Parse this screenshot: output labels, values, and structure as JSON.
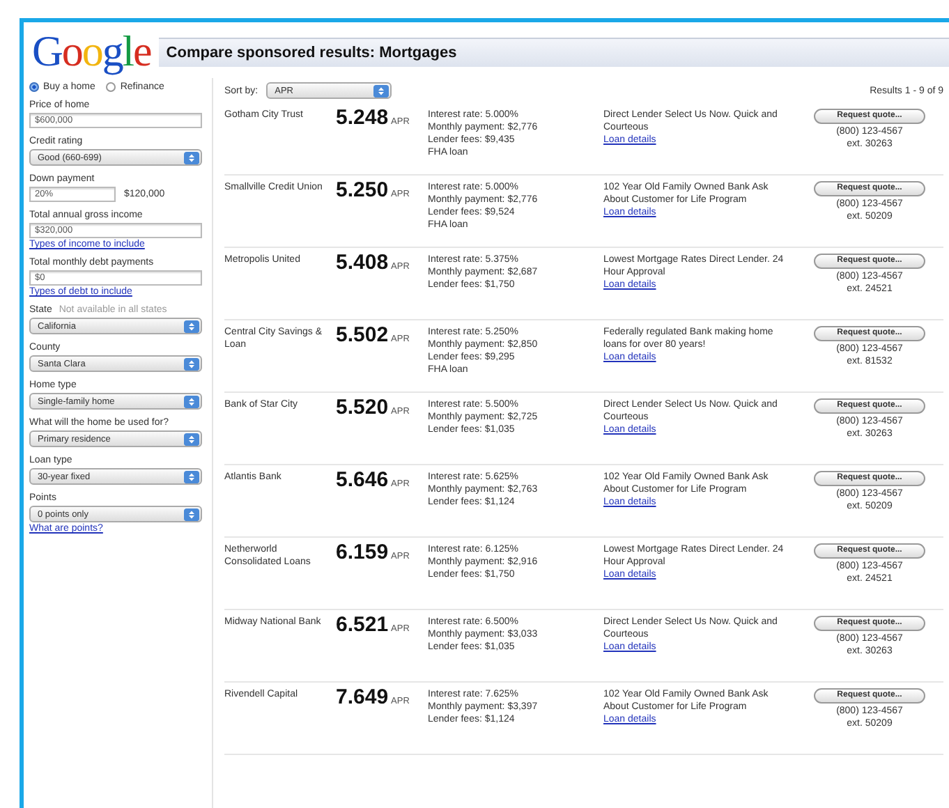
{
  "header": {
    "logo": "Google",
    "title": "Compare sponsored results: Mortgages"
  },
  "sidebar": {
    "purpose": [
      {
        "label": "Buy a home",
        "selected": true
      },
      {
        "label": "Refinance",
        "selected": false
      }
    ],
    "fields": [
      {
        "kind": "input",
        "label": "Price of home",
        "value": "$600,000"
      },
      {
        "kind": "select",
        "label": "Credit rating",
        "value": "Good (660-699)"
      },
      {
        "kind": "input",
        "label": "Down payment",
        "value": "20%",
        "amount": "$120,000"
      },
      {
        "kind": "input",
        "label": "Total annual gross income",
        "value": "$320,000",
        "link": "Types of income to include"
      },
      {
        "kind": "input",
        "label": "Total monthly debt payments",
        "value": "$0",
        "link": "Types of debt to include"
      },
      {
        "kind": "select",
        "label": "State",
        "note": "Not available in all states",
        "value": "California"
      },
      {
        "kind": "select",
        "label": "County",
        "value": "Santa Clara"
      },
      {
        "kind": "select",
        "label": "Home type",
        "value": "Single-family home"
      },
      {
        "kind": "select",
        "label": "What will the home be used for?",
        "value": "Primary residence"
      },
      {
        "kind": "select",
        "label": "Loan type",
        "value": "30-year fixed"
      },
      {
        "kind": "select",
        "label": "Points",
        "value": "0 points only",
        "link": "What are points?"
      }
    ]
  },
  "results": {
    "sort_label": "Sort by:",
    "sort_value": "APR",
    "count": "Results 1 - 9 of 9",
    "rows": [
      {
        "lender": "Gotham City Trust",
        "apr": "5.248",
        "apr_unit": "APR",
        "details": [
          "Interest rate: 5.000%",
          "Monthly payment: $2,776",
          "Lender fees: $9,435",
          "FHA loan"
        ],
        "blurb": "Direct Lender Select Us Now. Quick and Courteous",
        "link": "Loan details",
        "button": "Request quote...",
        "phone": "(800) 123-4567",
        "ext": "ext. 30263"
      },
      {
        "lender": "Smallville Credit Union",
        "apr": "5.250",
        "apr_unit": "APR",
        "details": [
          "Interest rate: 5.000%",
          "Monthly payment: $2,776",
          "Lender fees: $9,524",
          "FHA loan"
        ],
        "blurb": "102 Year Old Family Owned Bank Ask About Customer for Life Program",
        "link": "Loan details",
        "button": "Request quote...",
        "phone": "(800) 123-4567",
        "ext": "ext. 50209"
      },
      {
        "lender": "Metropolis United",
        "apr": "5.408",
        "apr_unit": "APR",
        "details": [
          "Interest rate: 5.375%",
          "Monthly payment: $2,687",
          "Lender fees: $1,750"
        ],
        "blurb": "Lowest Mortgage Rates Direct Lender. 24 Hour Approval",
        "link": "Loan details",
        "button": "Request quote...",
        "phone": "(800) 123-4567",
        "ext": "ext. 24521"
      },
      {
        "lender": "Central City Savings & Loan",
        "apr": "5.502",
        "apr_unit": "APR",
        "details": [
          "Interest rate: 5.250%",
          "Monthly payment: $2,850",
          "Lender fees: $9,295",
          "FHA loan"
        ],
        "blurb": "Federally regulated Bank making home loans for over 80 years!",
        "link": "Loan details",
        "button": "Request quote...",
        "phone": "(800) 123-4567",
        "ext": "ext. 81532"
      },
      {
        "lender": "Bank of Star City",
        "apr": "5.520",
        "apr_unit": "APR",
        "details": [
          "Interest rate: 5.500%",
          "Monthly payment: $2,725",
          "Lender fees: $1,035"
        ],
        "blurb": "Direct Lender Select Us Now. Quick and Courteous",
        "link": "Loan details",
        "button": "Request quote...",
        "phone": "(800) 123-4567",
        "ext": "ext. 30263"
      },
      {
        "lender": "Atlantis Bank",
        "apr": "5.646",
        "apr_unit": "APR",
        "details": [
          "Interest rate: 5.625%",
          "Monthly payment: $2,763",
          "Lender fees: $1,124"
        ],
        "blurb": "102 Year Old Family Owned Bank Ask About Customer for Life Program",
        "link": "Loan details",
        "button": "Request quote...",
        "phone": "(800) 123-4567",
        "ext": "ext. 50209"
      },
      {
        "lender": "Netherworld Consolidated Loans",
        "apr": "6.159",
        "apr_unit": "APR",
        "details": [
          "Interest rate: 6.125%",
          "Monthly payment: $2,916",
          "Lender fees: $1,750"
        ],
        "blurb": "Lowest Mortgage Rates Direct Lender. 24 Hour Approval",
        "link": "Loan details",
        "button": "Request quote...",
        "phone": "(800) 123-4567",
        "ext": "ext. 24521"
      },
      {
        "lender": "Midway National Bank",
        "apr": "6.521",
        "apr_unit": "APR",
        "details": [
          "Interest rate: 6.500%",
          "Monthly payment: $3,033",
          "Lender fees: $1,035"
        ],
        "blurb": "Direct Lender Select Us Now. Quick and Courteous",
        "link": "Loan details",
        "button": "Request quote...",
        "phone": "(800) 123-4567",
        "ext": "ext. 30263"
      },
      {
        "lender": "Rivendell Capital",
        "apr": "7.649",
        "apr_unit": "APR",
        "details": [
          "Interest rate: 7.625%",
          "Monthly payment: $3,397",
          "Lender fees: $1,124"
        ],
        "blurb": "102 Year Old Family Owned Bank Ask About Customer for Life Program",
        "link": "Loan details",
        "button": "Request quote...",
        "phone": "(800) 123-4567",
        "ext": "ext. 50209"
      }
    ]
  }
}
